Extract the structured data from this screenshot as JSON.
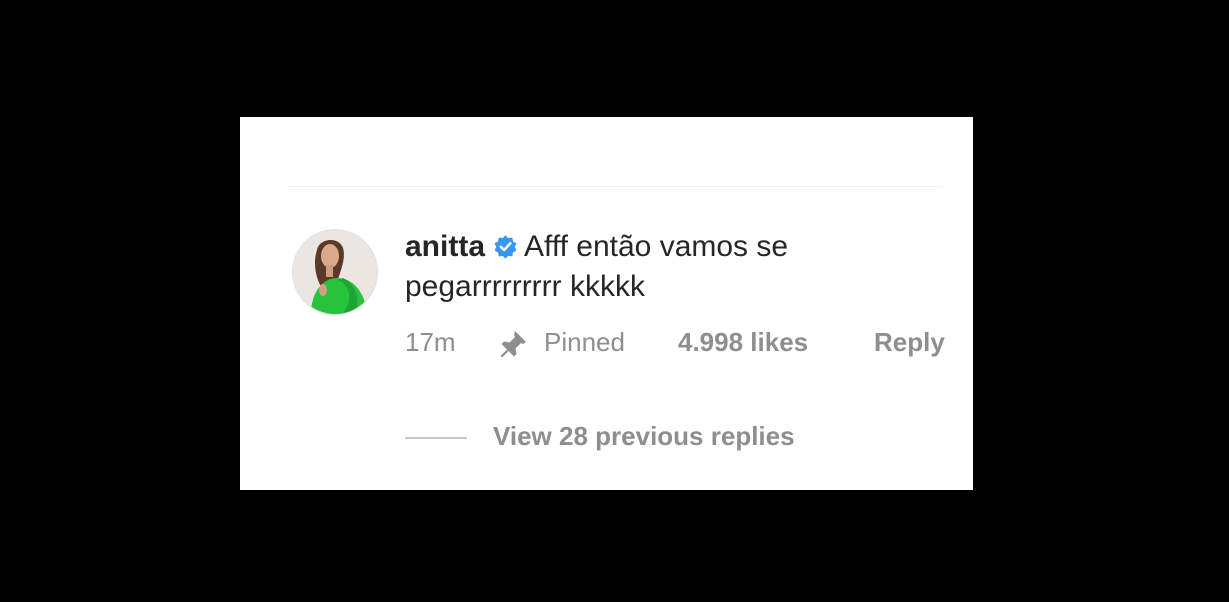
{
  "colors": {
    "background": "#000000",
    "card": "#ffffff",
    "text_primary": "#262626",
    "text_secondary": "#8e8e8e",
    "verified_badge": "#3897f0",
    "avatar_outfit": "#28c23c"
  },
  "comment": {
    "username": "anitta",
    "verified_icon": "verified-badge-icon",
    "text": "Afff então vamos se pegarrrrrrrrr  kkkkk",
    "avatar_icon": "profile-photo"
  },
  "meta": {
    "timestamp": "17m",
    "pin_icon": "pin-icon",
    "pinned_label": "Pinned",
    "likes": "4.998 likes",
    "reply_label": "Reply"
  },
  "replies": {
    "view_label": "View 28 previous replies"
  }
}
